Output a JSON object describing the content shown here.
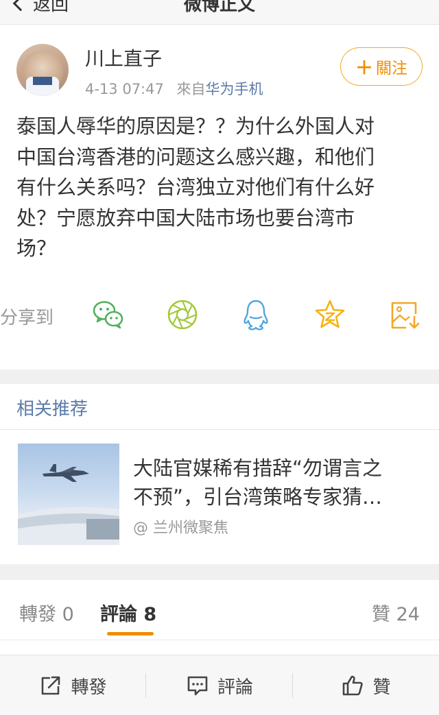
{
  "nav": {
    "back_label": "返回",
    "title": "微博正文"
  },
  "post": {
    "username": "川上直子",
    "time": "4-13 07:47",
    "source_prefix": "來自",
    "source_name": "华为手机",
    "follow_label": "關注",
    "text_lines": [
      "泰国人辱华的原因是？？为什么外国人对",
      "中国台湾香港的问题这么感兴趣，和他们",
      "有什么关系吗？台湾独立对他们有什么好",
      "处？宁愿放弃中国大陆市场也要台湾市",
      "场？"
    ]
  },
  "share": {
    "label": "分享到",
    "targets": [
      {
        "icon": "wechat-icon",
        "color": "#52b05f"
      },
      {
        "icon": "moments-icon",
        "color": "#a4c93b"
      },
      {
        "icon": "qq-icon",
        "color": "#4ea6e0"
      },
      {
        "icon": "qzone-icon",
        "color": "#f5b20f"
      },
      {
        "icon": "save-image-icon",
        "color": "#f5a623"
      }
    ]
  },
  "related": {
    "title": "相关推荐",
    "item": {
      "headline_line1": "大陆官媒稀有措辞“勿谓言之",
      "headline_line2": "不预”，引台湾策略专家猜…",
      "source": "@ 兰州微聚焦"
    }
  },
  "tabs": {
    "repost": "轉發 0",
    "comment": "評論 8",
    "like": "贊 24"
  },
  "toolbar": {
    "repost_label": "轉發",
    "comment_label": "評論",
    "like_label": "贊"
  },
  "colors": {
    "accent": "#f08c00",
    "link": "#5b7aa8"
  }
}
